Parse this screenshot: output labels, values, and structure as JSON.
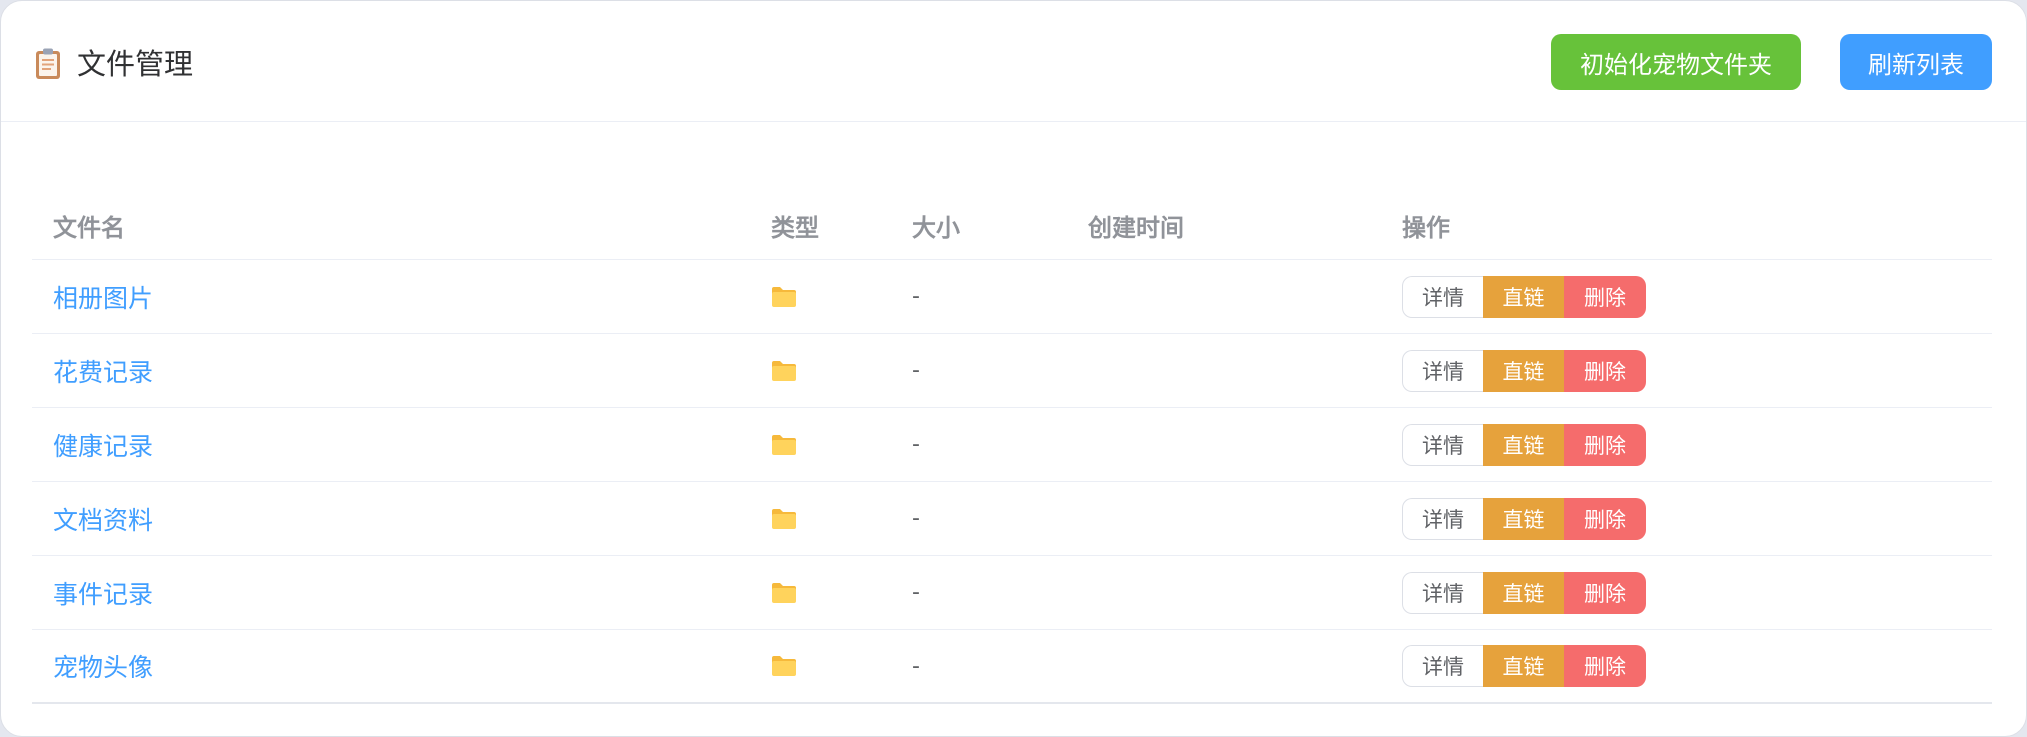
{
  "header": {
    "title": "文件管理",
    "title_icon": "clipboard-icon",
    "init_button": "初始化宠物文件夹",
    "refresh_button": "刷新列表"
  },
  "table": {
    "columns": [
      "文件名",
      "类型",
      "大小",
      "创建时间",
      "操作"
    ],
    "rows": [
      {
        "name": "相册图片",
        "type_icon": "folder-icon",
        "size": "-",
        "created": ""
      },
      {
        "name": "花费记录",
        "type_icon": "folder-icon",
        "size": "-",
        "created": ""
      },
      {
        "name": "健康记录",
        "type_icon": "folder-icon",
        "size": "-",
        "created": ""
      },
      {
        "name": "文档资料",
        "type_icon": "folder-icon",
        "size": "-",
        "created": ""
      },
      {
        "name": "事件记录",
        "type_icon": "folder-icon",
        "size": "-",
        "created": ""
      },
      {
        "name": "宠物头像",
        "type_icon": "folder-icon",
        "size": "-",
        "created": ""
      }
    ],
    "actions": {
      "detail": "详情",
      "link": "直链",
      "delete": "删除"
    }
  },
  "colors": {
    "primary": "#409eff",
    "success": "#67c23a",
    "warning": "#e6a23c",
    "danger": "#f56c6c"
  }
}
